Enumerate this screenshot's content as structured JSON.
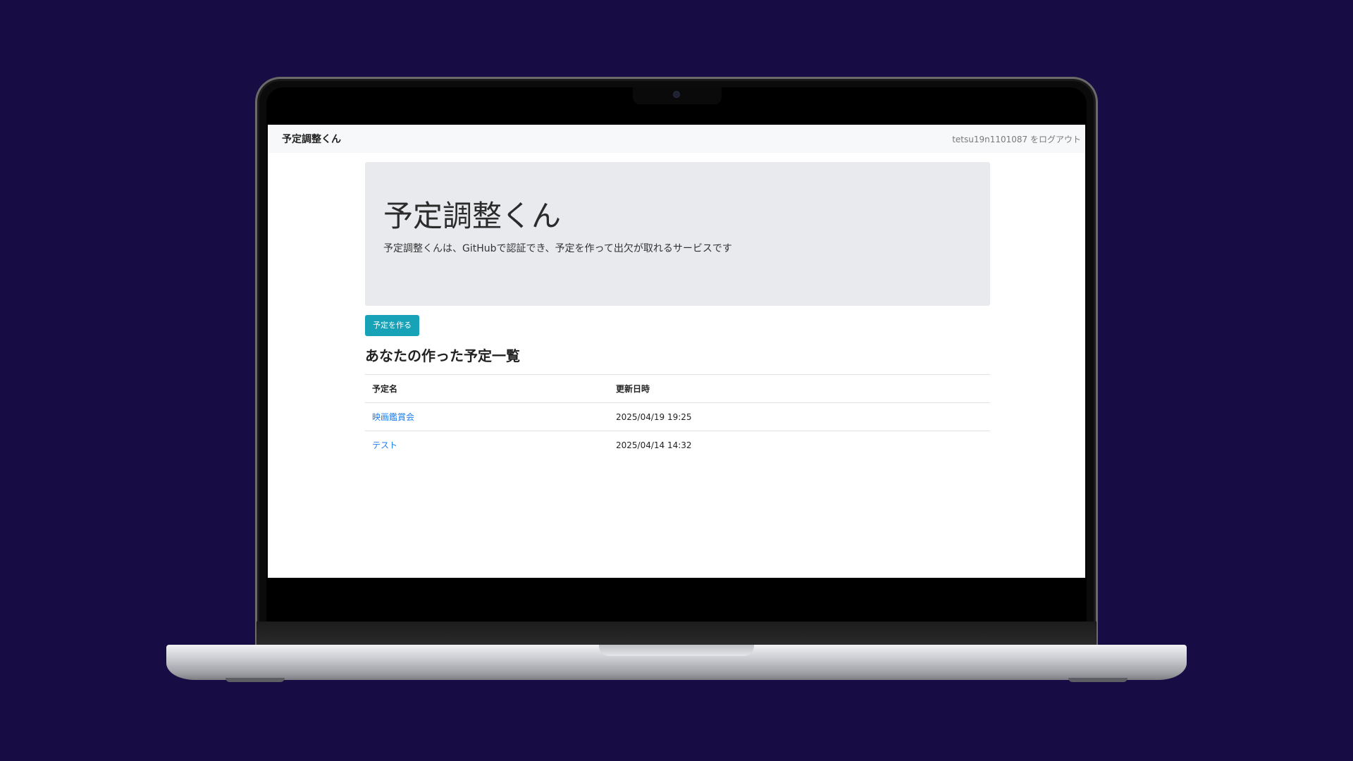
{
  "navbar": {
    "brand": "予定調整くん",
    "logout": "tetsu19n1101087 をログアウト"
  },
  "jumbotron": {
    "title": "予定調整くん",
    "lead": "予定調整くんは、GitHubで認証でき、予定を作って出欠が取れるサービスです"
  },
  "create_button": "予定を作る",
  "section_title": "あなたの作った予定一覧",
  "table": {
    "headers": [
      "予定名",
      "更新日時"
    ],
    "rows": [
      {
        "name": "映画鑑賞会",
        "updated": "2025/04/19 19:25"
      },
      {
        "name": "テスト",
        "updated": "2025/04/14 14:32"
      }
    ]
  },
  "colors": {
    "background": "#170d44",
    "button": "#17a2b8",
    "link": "#1e7ef0"
  }
}
